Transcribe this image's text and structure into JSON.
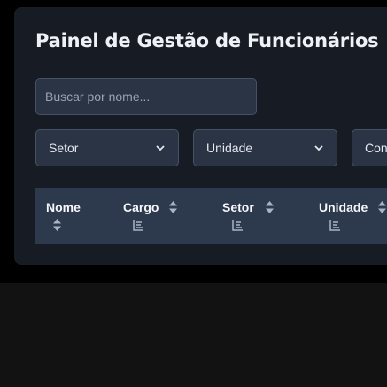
{
  "panel": {
    "title": "Painel de Gestão de Funcionários"
  },
  "search": {
    "placeholder": "Buscar por nome..."
  },
  "filters": [
    {
      "label": "Setor"
    },
    {
      "label": "Unidade"
    },
    {
      "label": "Con"
    }
  ],
  "table": {
    "columns": [
      {
        "label": "Nome",
        "icons": [
          "sort-icon"
        ]
      },
      {
        "label": "Cargo",
        "icons": [
          "sort-icon",
          "filter-icon"
        ]
      },
      {
        "label": "Setor",
        "icons": [
          "sort-icon",
          "filter-icon"
        ]
      },
      {
        "label": "Unidade",
        "icons": [
          "sort-icon",
          "filter-icon"
        ]
      }
    ]
  },
  "colors": {
    "background": "#121212",
    "panel": "#171b24",
    "input": "#2b3444",
    "input_border": "#465163",
    "table_header": "#2d3a4e",
    "icon": "#a9b4c4"
  }
}
